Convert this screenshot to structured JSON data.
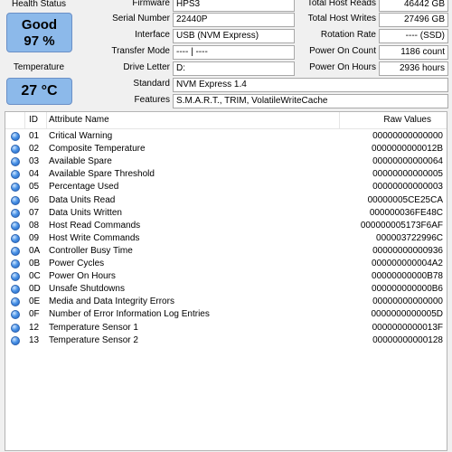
{
  "health": {
    "label": "Health Status",
    "status": "Good",
    "percent": "97 %",
    "color": "#8cb9ea"
  },
  "temperature": {
    "label": "Temperature",
    "value": "27 °C"
  },
  "info": {
    "firmware": {
      "label": "Firmware",
      "value": "HPS3"
    },
    "serial": {
      "label": "Serial Number",
      "value": "22440P"
    },
    "interface": {
      "label": "Interface",
      "value": "USB (NVM Express)"
    },
    "transfer_mode": {
      "label": "Transfer Mode",
      "value": "---- | ----"
    },
    "drive_letter": {
      "label": "Drive Letter",
      "value": "D:"
    },
    "standard": {
      "label": "Standard",
      "value": "NVM Express 1.4"
    },
    "features": {
      "label": "Features",
      "value": "S.M.A.R.T., TRIM, VolatileWriteCache"
    }
  },
  "stats": {
    "total_host_reads": {
      "label": "Total Host Reads",
      "value": "46442 GB"
    },
    "total_host_writes": {
      "label": "Total Host Writes",
      "value": "27496 GB"
    },
    "rotation_rate": {
      "label": "Rotation Rate",
      "value": "---- (SSD)"
    },
    "power_on_count": {
      "label": "Power On Count",
      "value": "1186 count"
    },
    "power_on_hours": {
      "label": "Power On Hours",
      "value": "2936 hours"
    }
  },
  "table": {
    "columns": {
      "id": "ID",
      "name": "Attribute Name",
      "raw": "Raw Values"
    },
    "status_icon": "blue-status-dot-icon",
    "rows": [
      {
        "id": "01",
        "name": "Critical Warning",
        "raw": "00000000000000"
      },
      {
        "id": "02",
        "name": "Composite Temperature",
        "raw": "0000000000012B"
      },
      {
        "id": "03",
        "name": "Available Spare",
        "raw": "00000000000064"
      },
      {
        "id": "04",
        "name": "Available Spare Threshold",
        "raw": "00000000000005"
      },
      {
        "id": "05",
        "name": "Percentage Used",
        "raw": "00000000000003"
      },
      {
        "id": "06",
        "name": "Data Units Read",
        "raw": "00000005CE25CA"
      },
      {
        "id": "07",
        "name": "Data Units Written",
        "raw": "000000036FE48C"
      },
      {
        "id": "08",
        "name": "Host Read Commands",
        "raw": "000000005173F6AF"
      },
      {
        "id": "09",
        "name": "Host Write Commands",
        "raw": "000003722996C"
      },
      {
        "id": "0A",
        "name": "Controller Busy Time",
        "raw": "00000000000936"
      },
      {
        "id": "0B",
        "name": "Power Cycles",
        "raw": "000000000004A2"
      },
      {
        "id": "0C",
        "name": "Power On Hours",
        "raw": "00000000000B78"
      },
      {
        "id": "0D",
        "name": "Unsafe Shutdowns",
        "raw": "000000000000B6"
      },
      {
        "id": "0E",
        "name": "Media and Data Integrity Errors",
        "raw": "00000000000000"
      },
      {
        "id": "0F",
        "name": "Number of Error Information Log Entries",
        "raw": "0000000000005D"
      },
      {
        "id": "12",
        "name": "Temperature Sensor 1",
        "raw": "0000000000013F"
      },
      {
        "id": "13",
        "name": "Temperature Sensor 2",
        "raw": "00000000000128"
      }
    ]
  }
}
